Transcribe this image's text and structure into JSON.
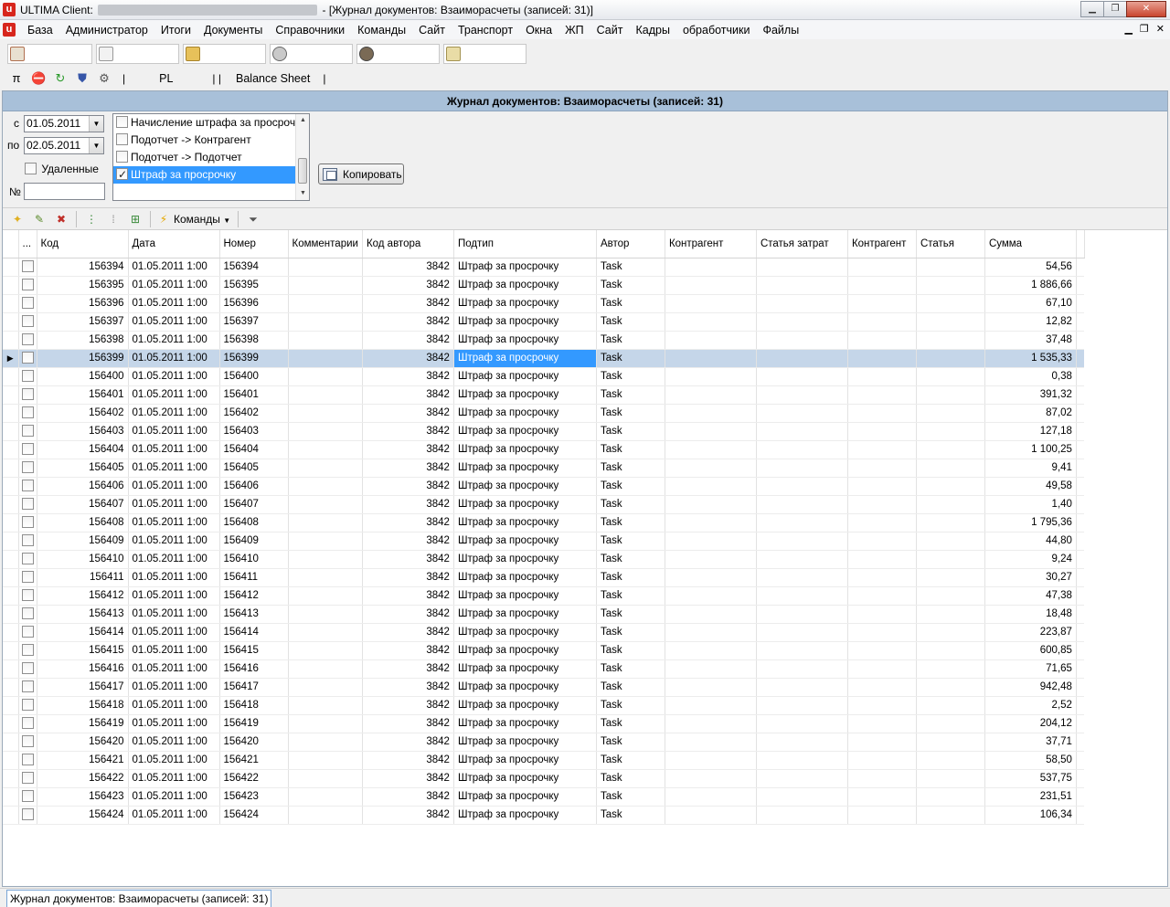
{
  "window": {
    "title_prefix": "ULTIMA Client:",
    "title_suffix": "- [Журнал документов: Взаиморасчеты (записей: 31)]"
  },
  "menu": [
    "База",
    "Администратор",
    "Итоги",
    "Документы",
    "Справочники",
    "Команды",
    "Сайт",
    "Транспорт",
    "Окна",
    "ЖП",
    "Сайт",
    "Кадры",
    "обработчики",
    "Файлы"
  ],
  "toolbar2": {
    "pl_label": "PL",
    "balance_label": "Balance Sheet"
  },
  "journal": {
    "title": "Журнал документов: Взаиморасчеты (записей: 31)"
  },
  "filter": {
    "from_label": "с",
    "from_value": "01.05.2011",
    "to_label": "по",
    "to_value": "02.05.2011",
    "deleted_label": "Удаленные",
    "number_label": "№",
    "types": [
      {
        "label": "Начисление штрафа за просрочку",
        "checked": false
      },
      {
        "label": "Подотчет -> Контрагент",
        "checked": false
      },
      {
        "label": "Подотчет -> Подотчет",
        "checked": false
      },
      {
        "label": "Штраф за просрочку",
        "checked": true
      }
    ],
    "copy_label": "Копировать"
  },
  "grid_toolbar": {
    "commands_label": "Команды"
  },
  "grid": {
    "columns": [
      "...",
      "Код",
      "Дата",
      "Номер",
      "Комментарии",
      "Код автора",
      "Подтип",
      "Автор",
      "Контрагент",
      "Статья затрат",
      "Контрагент",
      "Статья",
      "Сумма"
    ],
    "selected_row": 5,
    "rows": [
      [
        "156394",
        "01.05.2011 1:00",
        "156394",
        "",
        "3842",
        "Штраф за просрочку",
        "Task",
        "",
        "",
        "",
        "",
        "54,56"
      ],
      [
        "156395",
        "01.05.2011 1:00",
        "156395",
        "",
        "3842",
        "Штраф за просрочку",
        "Task",
        "",
        "",
        "",
        "",
        "1 886,66"
      ],
      [
        "156396",
        "01.05.2011 1:00",
        "156396",
        "",
        "3842",
        "Штраф за просрочку",
        "Task",
        "",
        "",
        "",
        "",
        "67,10"
      ],
      [
        "156397",
        "01.05.2011 1:00",
        "156397",
        "",
        "3842",
        "Штраф за просрочку",
        "Task",
        "",
        "",
        "",
        "",
        "12,82"
      ],
      [
        "156398",
        "01.05.2011 1:00",
        "156398",
        "",
        "3842",
        "Штраф за просрочку",
        "Task",
        "",
        "",
        "",
        "",
        "37,48"
      ],
      [
        "156399",
        "01.05.2011 1:00",
        "156399",
        "",
        "3842",
        "Штраф за просрочку",
        "Task",
        "",
        "",
        "",
        "",
        "1 535,33"
      ],
      [
        "156400",
        "01.05.2011 1:00",
        "156400",
        "",
        "3842",
        "Штраф за просрочку",
        "Task",
        "",
        "",
        "",
        "",
        "0,38"
      ],
      [
        "156401",
        "01.05.2011 1:00",
        "156401",
        "",
        "3842",
        "Штраф за просрочку",
        "Task",
        "",
        "",
        "",
        "",
        "391,32"
      ],
      [
        "156402",
        "01.05.2011 1:00",
        "156402",
        "",
        "3842",
        "Штраф за просрочку",
        "Task",
        "",
        "",
        "",
        "",
        "87,02"
      ],
      [
        "156403",
        "01.05.2011 1:00",
        "156403",
        "",
        "3842",
        "Штраф за просрочку",
        "Task",
        "",
        "",
        "",
        "",
        "127,18"
      ],
      [
        "156404",
        "01.05.2011 1:00",
        "156404",
        "",
        "3842",
        "Штраф за просрочку",
        "Task",
        "",
        "",
        "",
        "",
        "1 100,25"
      ],
      [
        "156405",
        "01.05.2011 1:00",
        "156405",
        "",
        "3842",
        "Штраф за просрочку",
        "Task",
        "",
        "",
        "",
        "",
        "9,41"
      ],
      [
        "156406",
        "01.05.2011 1:00",
        "156406",
        "",
        "3842",
        "Штраф за просрочку",
        "Task",
        "",
        "",
        "",
        "",
        "49,58"
      ],
      [
        "156407",
        "01.05.2011 1:00",
        "156407",
        "",
        "3842",
        "Штраф за просрочку",
        "Task",
        "",
        "",
        "",
        "",
        "1,40"
      ],
      [
        "156408",
        "01.05.2011 1:00",
        "156408",
        "",
        "3842",
        "Штраф за просрочку",
        "Task",
        "",
        "",
        "",
        "",
        "1 795,36"
      ],
      [
        "156409",
        "01.05.2011 1:00",
        "156409",
        "",
        "3842",
        "Штраф за просрочку",
        "Task",
        "",
        "",
        "",
        "",
        "44,80"
      ],
      [
        "156410",
        "01.05.2011 1:00",
        "156410",
        "",
        "3842",
        "Штраф за просрочку",
        "Task",
        "",
        "",
        "",
        "",
        "9,24"
      ],
      [
        "156411",
        "01.05.2011 1:00",
        "156411",
        "",
        "3842",
        "Штраф за просрочку",
        "Task",
        "",
        "",
        "",
        "",
        "30,27"
      ],
      [
        "156412",
        "01.05.2011 1:00",
        "156412",
        "",
        "3842",
        "Штраф за просрочку",
        "Task",
        "",
        "",
        "",
        "",
        "47,38"
      ],
      [
        "156413",
        "01.05.2011 1:00",
        "156413",
        "",
        "3842",
        "Штраф за просрочку",
        "Task",
        "",
        "",
        "",
        "",
        "18,48"
      ],
      [
        "156414",
        "01.05.2011 1:00",
        "156414",
        "",
        "3842",
        "Штраф за просрочку",
        "Task",
        "",
        "",
        "",
        "",
        "223,87"
      ],
      [
        "156415",
        "01.05.2011 1:00",
        "156415",
        "",
        "3842",
        "Штраф за просрочку",
        "Task",
        "",
        "",
        "",
        "",
        "600,85"
      ],
      [
        "156416",
        "01.05.2011 1:00",
        "156416",
        "",
        "3842",
        "Штраф за просрочку",
        "Task",
        "",
        "",
        "",
        "",
        "71,65"
      ],
      [
        "156417",
        "01.05.2011 1:00",
        "156417",
        "",
        "3842",
        "Штраф за просрочку",
        "Task",
        "",
        "",
        "",
        "",
        "942,48"
      ],
      [
        "156418",
        "01.05.2011 1:00",
        "156418",
        "",
        "3842",
        "Штраф за просрочку",
        "Task",
        "",
        "",
        "",
        "",
        "2,52"
      ],
      [
        "156419",
        "01.05.2011 1:00",
        "156419",
        "",
        "3842",
        "Штраф за просрочку",
        "Task",
        "",
        "",
        "",
        "",
        "204,12"
      ],
      [
        "156420",
        "01.05.2011 1:00",
        "156420",
        "",
        "3842",
        "Штраф за просрочку",
        "Task",
        "",
        "",
        "",
        "",
        "37,71"
      ],
      [
        "156421",
        "01.05.2011 1:00",
        "156421",
        "",
        "3842",
        "Штраф за просрочку",
        "Task",
        "",
        "",
        "",
        "",
        "58,50"
      ],
      [
        "156422",
        "01.05.2011 1:00",
        "156422",
        "",
        "3842",
        "Штраф за просрочку",
        "Task",
        "",
        "",
        "",
        "",
        "537,75"
      ],
      [
        "156423",
        "01.05.2011 1:00",
        "156423",
        "",
        "3842",
        "Штраф за просрочку",
        "Task",
        "",
        "",
        "",
        "",
        "231,51"
      ],
      [
        "156424",
        "01.05.2011 1:00",
        "156424",
        "",
        "3842",
        "Штраф за просрочку",
        "Task",
        "",
        "",
        "",
        "",
        "106,34"
      ]
    ]
  },
  "statusbar": {
    "tab_label": "Журнал документов: Взаиморасчеты (записей: 31)"
  },
  "colors": {
    "accent": "#3399ff",
    "header_band": "#a8c0d9",
    "selected_row": "#c5d6e9",
    "logo": "#d7261d"
  }
}
